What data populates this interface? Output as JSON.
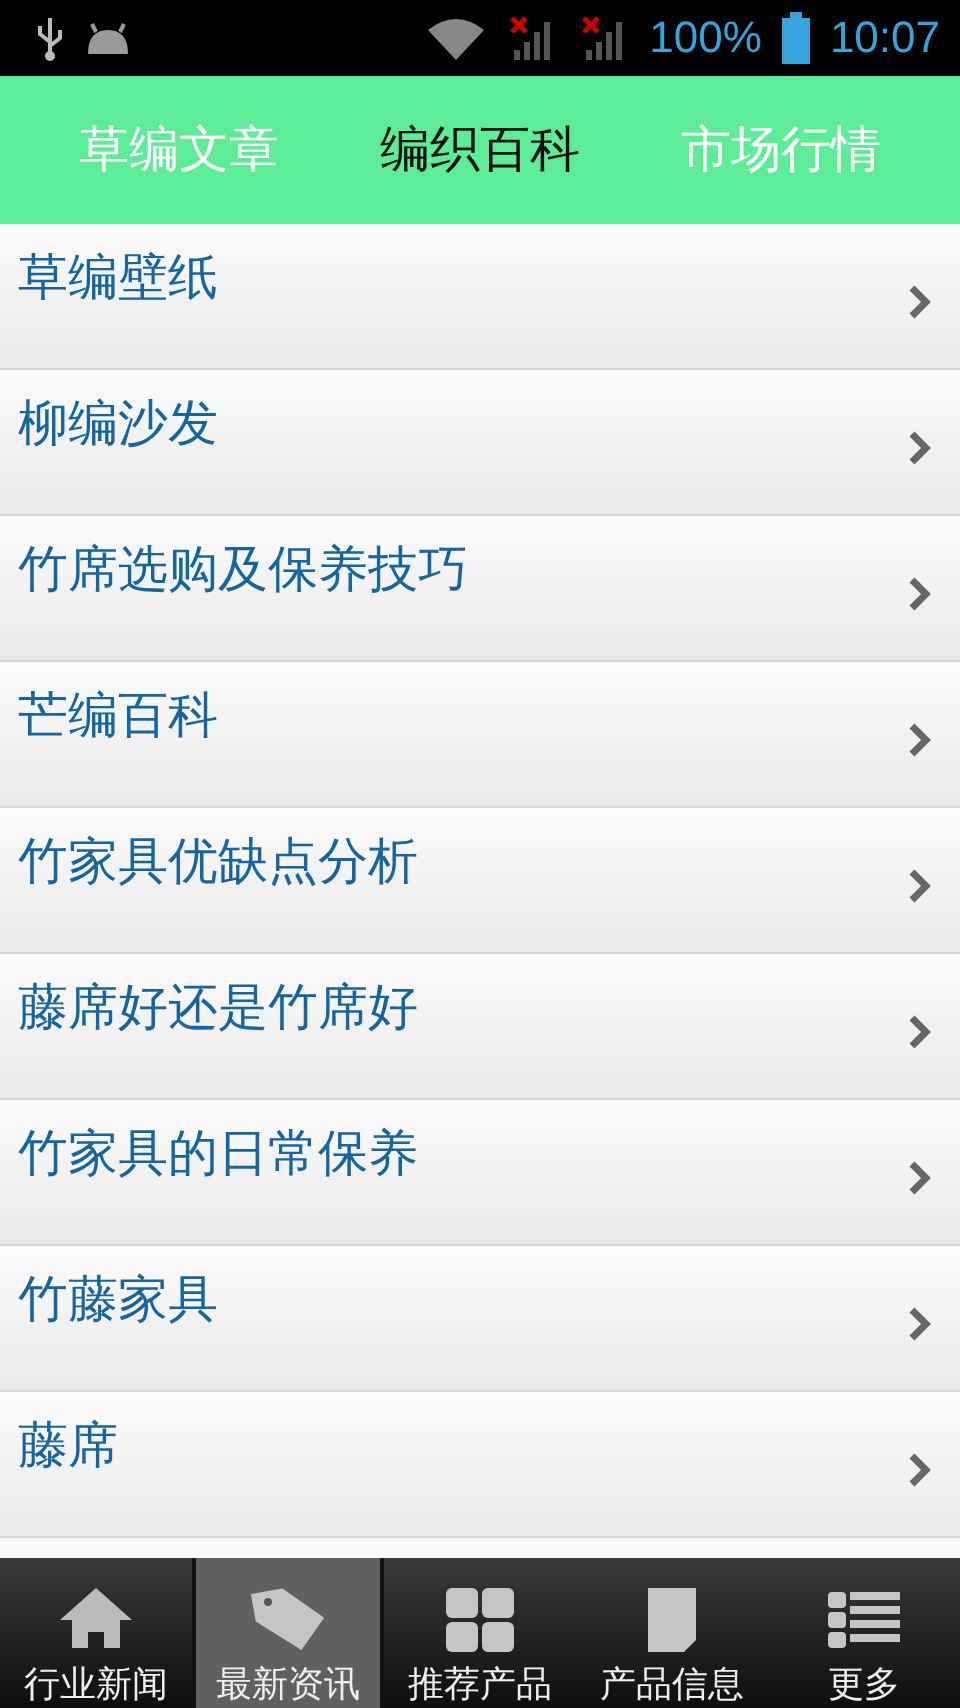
{
  "status_bar": {
    "battery": "100%",
    "time": "10:07"
  },
  "tabs": [
    {
      "label": "草编文章",
      "selected": false
    },
    {
      "label": "编织百科",
      "selected": true
    },
    {
      "label": "市场行情",
      "selected": false
    }
  ],
  "articles": [
    {
      "title": "草编壁纸"
    },
    {
      "title": "柳编沙发"
    },
    {
      "title": "竹席选购及保养技巧"
    },
    {
      "title": "芒编百科"
    },
    {
      "title": "竹家具优缺点分析"
    },
    {
      "title": "藤席好还是竹席好"
    },
    {
      "title": "竹家具的日常保养"
    },
    {
      "title": "竹藤家具"
    },
    {
      "title": "藤席"
    }
  ],
  "bottom_nav": [
    {
      "label": "行业新闻",
      "kind": "home",
      "selected": false
    },
    {
      "label": "最新资讯",
      "kind": "tag",
      "selected": true
    },
    {
      "label": "推荐产品",
      "kind": "grid",
      "selected": false
    },
    {
      "label": "产品信息",
      "kind": "page",
      "selected": false
    },
    {
      "label": "更多",
      "kind": "list",
      "selected": false
    }
  ]
}
